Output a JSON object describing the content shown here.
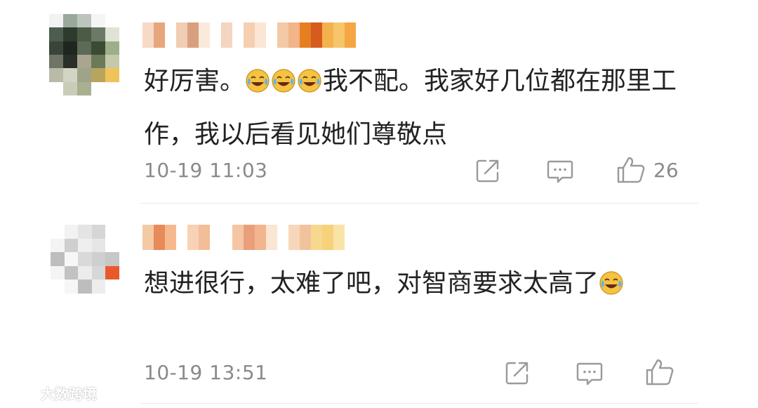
{
  "comments": [
    {
      "avatar_pixels": [
        "#f2f2f2",
        "#9aa89a",
        "#bcc4bc",
        "#f5f5f5",
        "#ffffff",
        "#4d5d4d",
        "#2f3a2f",
        "#4d5a45",
        "#6b7a64",
        "#dfe3d6",
        "#3a4438",
        "#1f2620",
        "#5e6a58",
        "#3b4a33",
        "#9fae8a",
        "#6e7566",
        "#2b2f29",
        "#a9a58f",
        "#6d7a5a",
        "#c5c9a9",
        "#b8bba8",
        "#d2d4c4",
        "#9ea487",
        "#b9a45e",
        "#f0c35a",
        "#ffffff",
        "#c9cdb8",
        "#a9b08f",
        "#ffffff",
        "#ffffff"
      ],
      "nickname_pixels": [
        "#f7d9c6",
        "#e8a67d",
        "#ffffff",
        "#f1cdb3",
        "#d9a07f",
        "#fbe9dc",
        "#ffffff",
        "#f4d5bf",
        "#ffffff",
        "#f6cfb0",
        "#fbe6d6",
        "#ffffff",
        "#f3c9a6",
        "#f2b489",
        "#e67e22",
        "#d65b1f",
        "#f3b24c",
        "#f7c56c",
        "#f4a742"
      ],
      "text_parts": [
        "好厉害。",
        "我不配。我家好几位都在那里工作，我以后看见她们尊敬点"
      ],
      "emoji_name": "laughing-crying-emoji",
      "timestamp": "10-19 11:03",
      "like_count": "26"
    },
    {
      "avatar_pixels": [
        "#ffffff",
        "#f2f2f2",
        "#e4e4e4",
        "#d6d6d6",
        "#ffffff",
        "#f4f4f4",
        "#cfcfcf",
        "#efefef",
        "#e6e6e6",
        "#ffffff",
        "#bdbdbd",
        "#f7f7f7",
        "#d9d9d9",
        "#cfcfcf",
        "#c7c7c7",
        "#f4f4f4",
        "#c2c2c2",
        "#ececec",
        "#d7d7d7",
        "#e85a2c",
        "#ffffff",
        "#f6f6f6",
        "#bdbdbd",
        "#ededed",
        "#ffffff"
      ],
      "nickname_pixels": [
        "#f4caa5",
        "#e88a5a",
        "#f6b98d",
        "#ffffff",
        "#f8d2b4",
        "#f3bd98",
        "#ffffff",
        "#ffffff",
        "#f5c6a3",
        "#e9a07a",
        "#f2b590",
        "#fbe5d3",
        "#ffffff",
        "#f7d7bb",
        "#f1c39d",
        "#f7d88f",
        "#f6d27a",
        "#f9e3a6"
      ],
      "text_parts": [
        "想进很行，太难了吧，对智商要求太高了"
      ],
      "emoji_name": "laughing-crying-emoji",
      "timestamp": "10-19 13:51",
      "like_count": ""
    }
  ],
  "watermark": {
    "text": "大数跨境",
    "icon_name": "weibo-logo-icon"
  },
  "colors": {
    "text": "#222222",
    "meta": "#8a8a8a",
    "divider": "#ebebeb",
    "emoji_face": "#f5c342"
  }
}
